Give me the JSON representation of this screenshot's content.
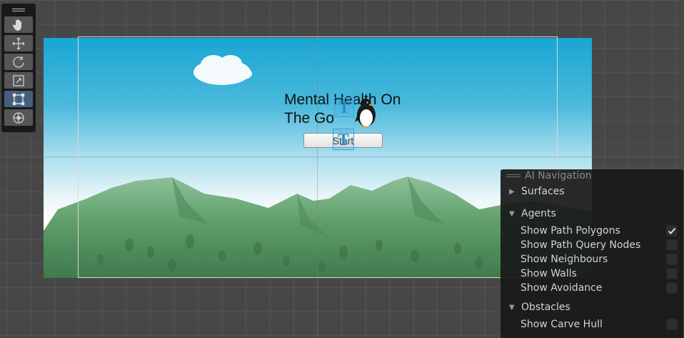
{
  "scene": {
    "title_text": "Mental Health On The Go",
    "start_button_label": "Start",
    "text_gizmo_glyph": "T"
  },
  "tools": [
    {
      "name": "view-tool",
      "icon": "hand-icon",
      "active": false
    },
    {
      "name": "move-tool",
      "icon": "move-icon",
      "active": false
    },
    {
      "name": "rotate-tool",
      "icon": "rotate-icon",
      "active": false
    },
    {
      "name": "scale-tool",
      "icon": "scale-icon",
      "active": false
    },
    {
      "name": "rect-tool",
      "icon": "rect-transform-icon",
      "active": true
    },
    {
      "name": "transform-tool",
      "icon": "transform-icon",
      "active": false
    }
  ],
  "ai_navigation": {
    "title": "AI Navigation",
    "sections": {
      "surfaces": {
        "label": "Surfaces",
        "expanded": false
      },
      "agents": {
        "label": "Agents",
        "expanded": true,
        "options": [
          {
            "label": "Show Path Polygons",
            "checked": true
          },
          {
            "label": "Show Path Query Nodes",
            "checked": false
          },
          {
            "label": "Show Neighbours",
            "checked": false
          },
          {
            "label": "Show Walls",
            "checked": false
          },
          {
            "label": "Show Avoidance",
            "checked": false
          }
        ]
      },
      "obstacles": {
        "label": "Obstacles",
        "expanded": true,
        "options": [
          {
            "label": "Show Carve Hull",
            "checked": false
          }
        ]
      }
    }
  },
  "colors": {
    "sky_top": "#19a6d3",
    "mountain": "#5f9e6a",
    "selection_blue": "#34a3e0",
    "active_tool": "#46607c"
  }
}
